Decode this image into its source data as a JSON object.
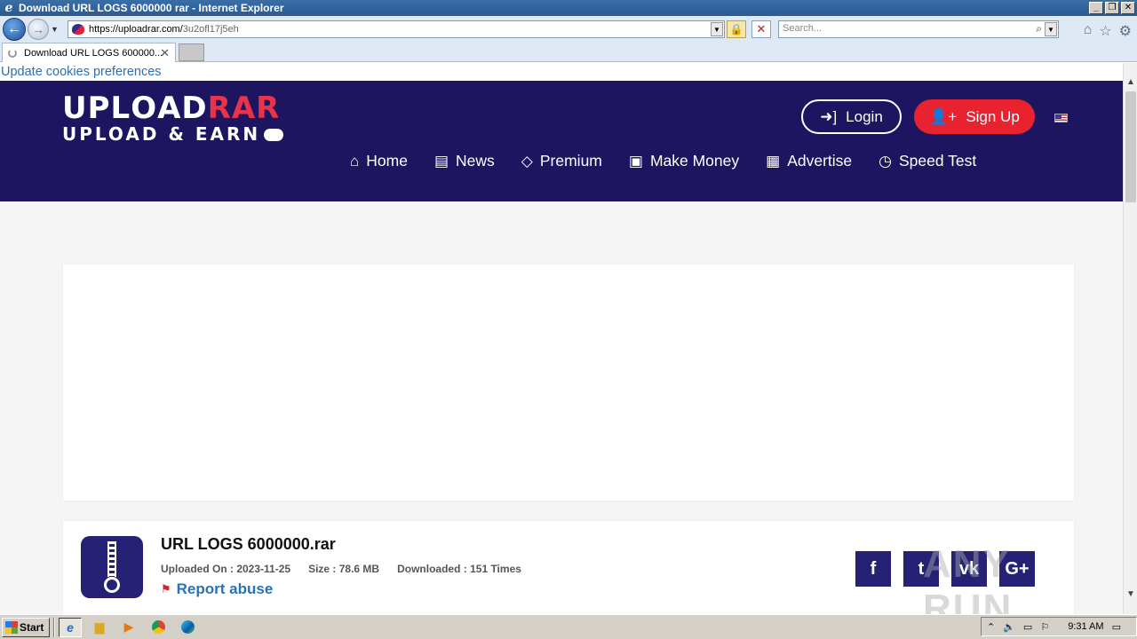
{
  "window": {
    "title": "Download URL LOGS 6000000 rar - Internet Explorer",
    "buttons": [
      "_",
      "❐",
      "✕"
    ]
  },
  "browser": {
    "url_host": "https://uploadrar.com/",
    "url_path": "3u2ofl17j5eh",
    "search_placeholder": "Search...",
    "tab_label": "Download URL LOGS 600000...",
    "tab_close": "✕"
  },
  "page": {
    "cookies_link": "Update cookies preferences",
    "logo": {
      "brand_a": "UPL",
      "brand_b": "ΟAD",
      "brand_c": "RAR",
      "tagline": "UPLOAD & EARN"
    },
    "header_buttons": {
      "login": "Login",
      "signup": "Sign Up"
    },
    "menu": [
      {
        "label": "Home",
        "icon": "home-icon",
        "glyph": "⌂"
      },
      {
        "label": "News",
        "icon": "newspaper-icon",
        "glyph": "▤"
      },
      {
        "label": "Premium",
        "icon": "diamond-icon",
        "glyph": "◇"
      },
      {
        "label": "Make Money",
        "icon": "money-icon",
        "glyph": "▣"
      },
      {
        "label": "Advertise",
        "icon": "ad-icon",
        "glyph": "▦"
      },
      {
        "label": "Speed Test",
        "icon": "clock-icon",
        "glyph": "◷"
      }
    ],
    "file": {
      "name": "URL LOGS 6000000.rar",
      "uploaded_on": "Uploaded On : 2023-11-25",
      "size": "Size : 78.6 MB",
      "downloaded": "Downloaded : 151 Times",
      "report": "Report abuse"
    },
    "social": [
      {
        "name": "facebook",
        "glyph": "f"
      },
      {
        "name": "twitter",
        "glyph": "t"
      },
      {
        "name": "vk",
        "glyph": "vk"
      },
      {
        "name": "google-plus",
        "glyph": "G+"
      }
    ],
    "watermark": "ANY RUN"
  },
  "taskbar": {
    "start": "Start",
    "clock": "9:31 AM"
  },
  "colors": {
    "header_bg": "#1e1560",
    "accent_red": "#e8222e",
    "link_blue": "#2a72b5"
  }
}
